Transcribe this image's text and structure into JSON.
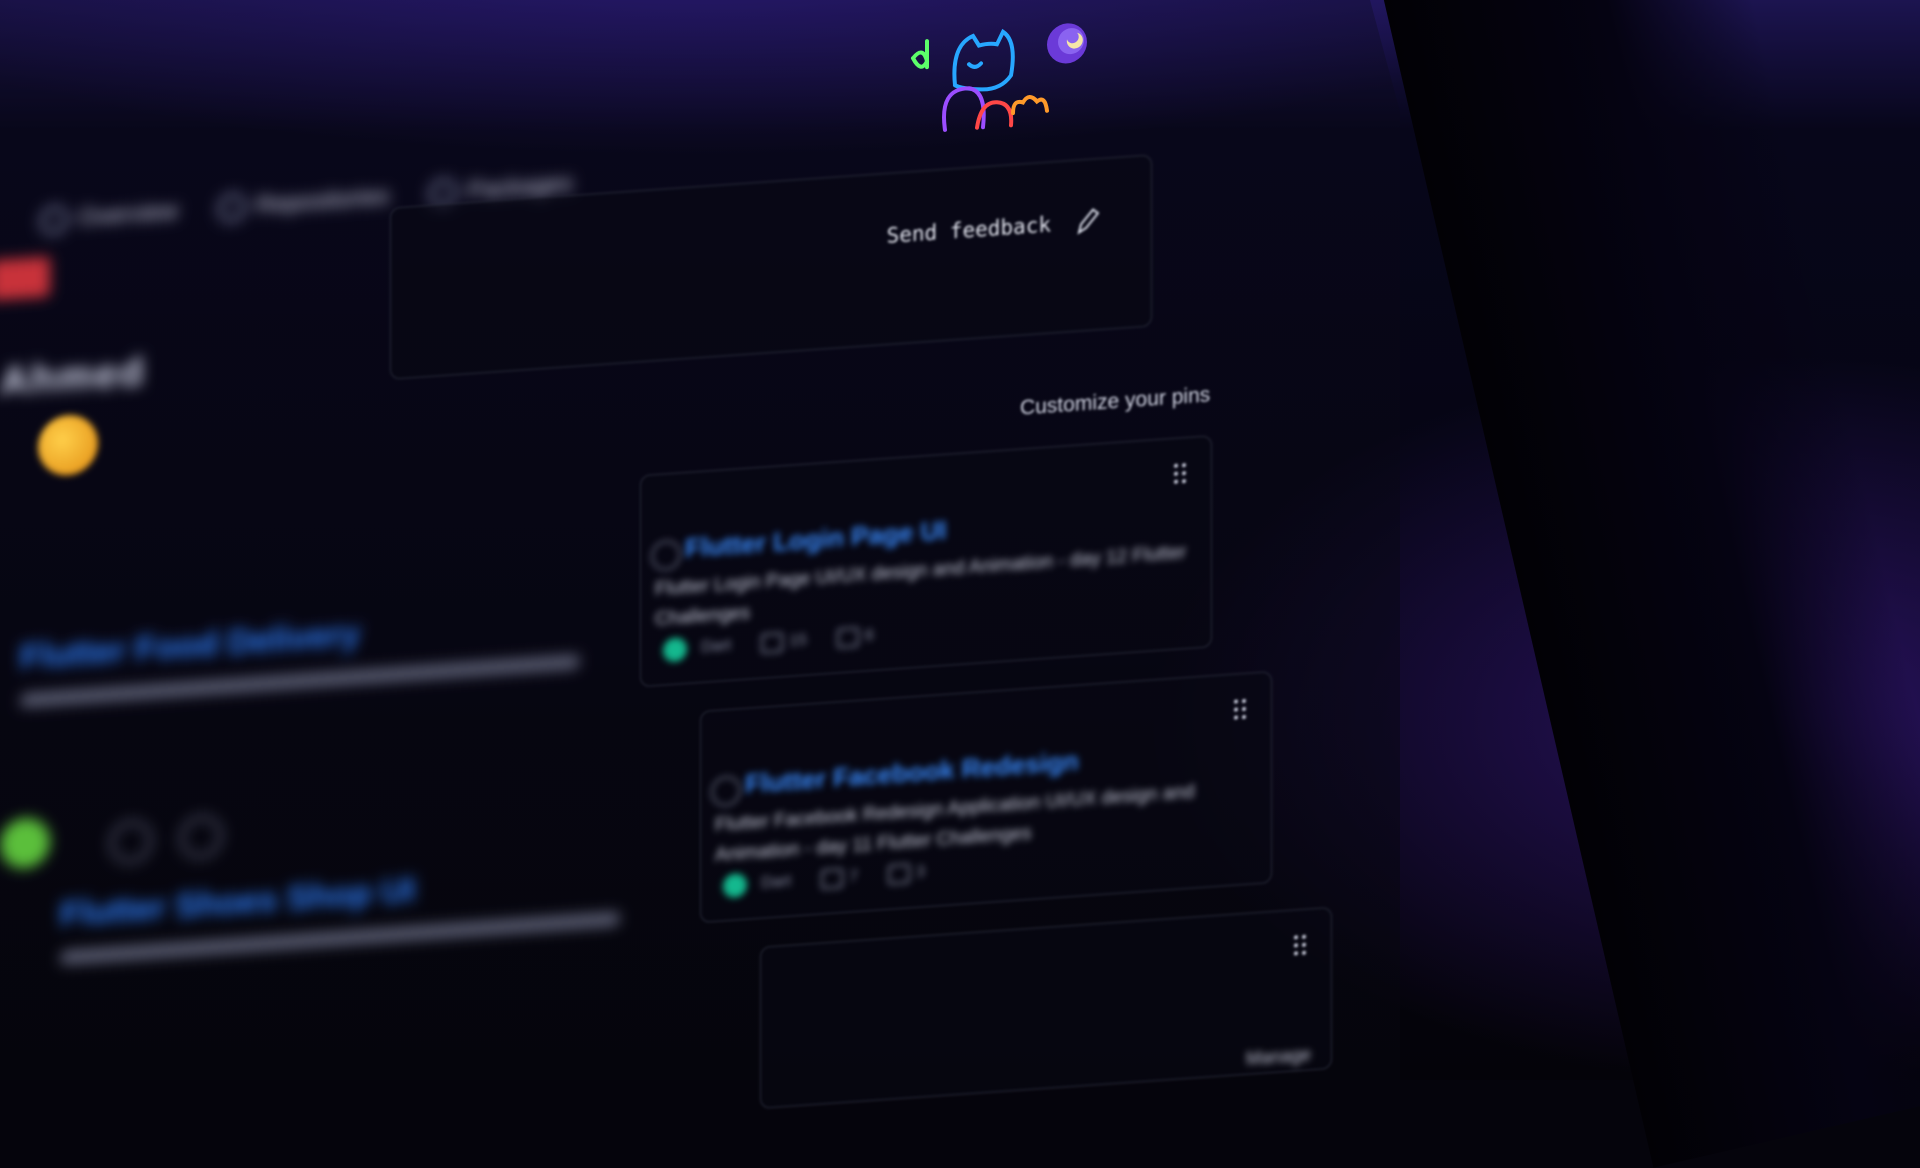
{
  "header": {
    "tabs": [
      {
        "label": "Overview"
      },
      {
        "label": "Repositories"
      },
      {
        "label": "Packages"
      }
    ],
    "user_display_name": "Ahmed"
  },
  "feedback_card": {
    "label": "Send feedback"
  },
  "pins_section": {
    "title": "Customize your pins",
    "manage_label": "Manage"
  },
  "pins": [
    {
      "title": "Flutter Login Page UI",
      "description": "Flutter Login Page UI/UX design and Animation - day 12 Flutter Challenges",
      "language_color": "#14b88e",
      "language": "Dart",
      "stars": "15",
      "forks": "6"
    },
    {
      "title": "Flutter Facebook Redesign",
      "description": "Flutter Facebook Redesign Application UI/UX design and Animation - day 11 Flutter Challenges",
      "language_color": "#14b88e",
      "language": "Dart",
      "stars": "7",
      "forks": "3"
    }
  ],
  "left_column": {
    "repo_titles": [
      "Flutter Food Delivery",
      "Flutter Shoes Shop UI"
    ]
  },
  "colors": {
    "accent_link": "#3a8cff",
    "background": "#05040c",
    "card_border": "#2a2d3c"
  }
}
